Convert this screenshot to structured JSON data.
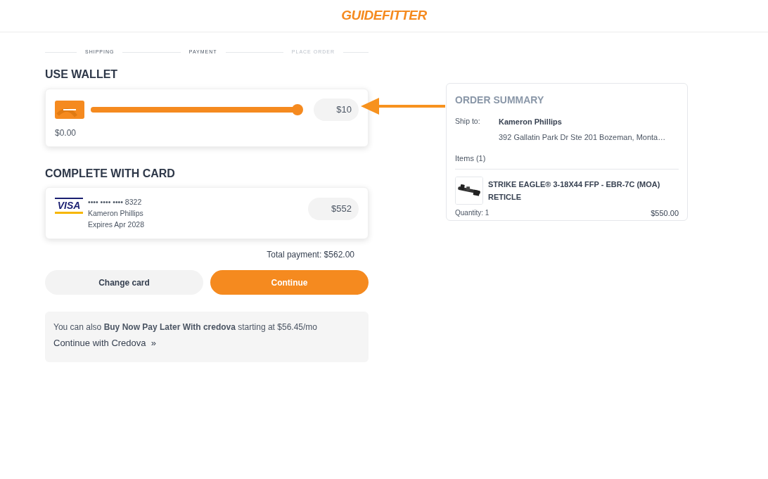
{
  "header": {
    "logo": "GUIDEFITTER"
  },
  "steps": [
    {
      "label": "SHIPPING",
      "disabled": false
    },
    {
      "label": "PAYMENT",
      "disabled": false
    },
    {
      "label": "PLACE ORDER",
      "disabled": true
    }
  ],
  "wallet": {
    "title": "USE WALLET",
    "slider": {
      "level": 1
    },
    "amount": "$10",
    "balance": "$0.00"
  },
  "card_section": {
    "title": "COMPLETE WITH CARD",
    "brand": "VISA",
    "number": "•••• •••• •••• 8322",
    "holder": "Kameron Phillips",
    "expires": "Expires Apr 2028",
    "amount": "$552"
  },
  "total": "Total payment: $562.00",
  "buttons": [
    {
      "label": "Change card",
      "kind": "secondary"
    },
    {
      "label": "Continue",
      "kind": "primary"
    }
  ],
  "credova": {
    "text": "You can also **Buy Now Pay Later With** **credova** starting at $56.45/mo",
    "link": "Continue with Credova",
    "link_icon": "»"
  },
  "order_summary": {
    "title": "ORDER SUMMARY",
    "ship_to_label": "Ship to:",
    "name": "Kameron Phillips",
    "address": "392 Gallatin Park Dr Ste 201 Bozeman, Monta…",
    "items_label": "Items (1)",
    "items": [
      {
        "name": "STRIKE EAGLE® 3-18X44 FFP - EBR-7C (MOA) RETICLE",
        "quantity": "Quantity: 1",
        "price": "$550.00"
      }
    ]
  }
}
